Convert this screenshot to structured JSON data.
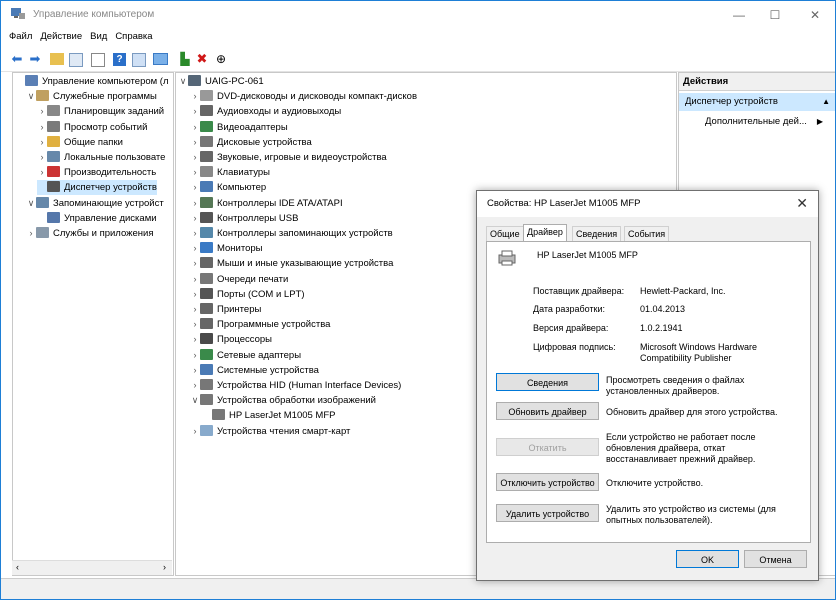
{
  "window": {
    "title": "Управление компьютером"
  },
  "menu": [
    "Файл",
    "Действие",
    "Вид",
    "Справка"
  ],
  "left_tree": [
    {
      "label": "Управление компьютером (л",
      "exp": "",
      "indent": 0,
      "color": "#5a7fb5"
    },
    {
      "label": "Служебные программы",
      "exp": "∨",
      "indent": 1,
      "color": "#c0a060"
    },
    {
      "label": "Планировщик заданий",
      "exp": "›",
      "indent": 2,
      "color": "#888"
    },
    {
      "label": "Просмотр событий",
      "exp": "›",
      "indent": 2,
      "color": "#7a7a7a"
    },
    {
      "label": "Общие папки",
      "exp": "›",
      "indent": 2,
      "color": "#e0b040"
    },
    {
      "label": "Локальные пользовате",
      "exp": "›",
      "indent": 2,
      "color": "#6688aa"
    },
    {
      "label": "Производительность",
      "exp": "›",
      "indent": 2,
      "color": "#cc3333"
    },
    {
      "label": "Диспетчер устройств",
      "exp": "",
      "indent": 2,
      "color": "#555",
      "selected": true
    },
    {
      "label": "Запоминающие устройст",
      "exp": "∨",
      "indent": 1,
      "color": "#6688aa"
    },
    {
      "label": "Управление дисками",
      "exp": "",
      "indent": 2,
      "color": "#5577aa"
    },
    {
      "label": "Службы и приложения",
      "exp": "›",
      "indent": 1,
      "color": "#8899aa"
    }
  ],
  "device_tree": [
    {
      "label": "UAIG-PC-061",
      "exp": "∨",
      "indent": 0,
      "color": "#556677"
    },
    {
      "label": "DVD-дисководы и дисководы компакт-дисков",
      "exp": "›",
      "indent": 1,
      "color": "#999"
    },
    {
      "label": "Аудиовходы и аудиовыходы",
      "exp": "›",
      "indent": 1,
      "color": "#666"
    },
    {
      "label": "Видеоадаптеры",
      "exp": "›",
      "indent": 1,
      "color": "#3a8a4a"
    },
    {
      "label": "Дисковые устройства",
      "exp": "›",
      "indent": 1,
      "color": "#777"
    },
    {
      "label": "Звуковые, игровые и видеоустройства",
      "exp": "›",
      "indent": 1,
      "color": "#666"
    },
    {
      "label": "Клавиатуры",
      "exp": "›",
      "indent": 1,
      "color": "#888"
    },
    {
      "label": "Компьютер",
      "exp": "›",
      "indent": 1,
      "color": "#4a7ab5"
    },
    {
      "label": "Контроллеры IDE ATA/ATAPI",
      "exp": "›",
      "indent": 1,
      "color": "#557755"
    },
    {
      "label": "Контроллеры USB",
      "exp": "›",
      "indent": 1,
      "color": "#555"
    },
    {
      "label": "Контроллеры запоминающих устройств",
      "exp": "›",
      "indent": 1,
      "color": "#5588aa"
    },
    {
      "label": "Мониторы",
      "exp": "›",
      "indent": 1,
      "color": "#3a7ac5"
    },
    {
      "label": "Мыши и иные указывающие устройства",
      "exp": "›",
      "indent": 1,
      "color": "#666"
    },
    {
      "label": "Очереди печати",
      "exp": "›",
      "indent": 1,
      "color": "#777"
    },
    {
      "label": "Порты (COM и LPT)",
      "exp": "›",
      "indent": 1,
      "color": "#555"
    },
    {
      "label": "Принтеры",
      "exp": "›",
      "indent": 1,
      "color": "#666"
    },
    {
      "label": "Программные устройства",
      "exp": "›",
      "indent": 1,
      "color": "#666"
    },
    {
      "label": "Процессоры",
      "exp": "›",
      "indent": 1,
      "color": "#4a4a4a"
    },
    {
      "label": "Сетевые адаптеры",
      "exp": "›",
      "indent": 1,
      "color": "#3a8a4a"
    },
    {
      "label": "Системные устройства",
      "exp": "›",
      "indent": 1,
      "color": "#4a7ab5"
    },
    {
      "label": "Устройства HID (Human Interface Devices)",
      "exp": "›",
      "indent": 1,
      "color": "#777"
    },
    {
      "label": "Устройства обработки изображений",
      "exp": "∨",
      "indent": 1,
      "color": "#777"
    },
    {
      "label": "HP LaserJet M1005 MFP",
      "exp": "",
      "indent": 2,
      "color": "#777"
    },
    {
      "label": "Устройства чтения смарт-карт",
      "exp": "›",
      "indent": 1,
      "color": "#88aacc"
    }
  ],
  "actions": {
    "header": "Действия",
    "item1": "Диспетчер устройств",
    "item2": "Дополнительные дей..."
  },
  "dialog": {
    "title": "Свойства: HP LaserJet M1005 MFP",
    "tabs": [
      "Общие",
      "Драйвер",
      "Сведения",
      "События"
    ],
    "device_name": "HP LaserJet M1005 MFP",
    "props": [
      {
        "label": "Поставщик драйвера:",
        "value": "Hewlett-Packard, Inc."
      },
      {
        "label": "Дата разработки:",
        "value": "01.04.2013"
      },
      {
        "label": "Версия драйвера:",
        "value": "1.0.2.1941"
      },
      {
        "label": "Цифровая подпись:",
        "value": "Microsoft Windows Hardware Compatibility Publisher"
      }
    ],
    "buttons": [
      {
        "label": "Сведения",
        "desc": "Просмотреть сведения о файлах установленных драйверов."
      },
      {
        "label": "Обновить драйвер",
        "desc": "Обновить драйвер для этого устройства."
      },
      {
        "label": "Откатить",
        "desc": "Если устройство не работает после обновления драйвера, откат восстанавливает прежний драйвер."
      },
      {
        "label": "Отключить устройство",
        "desc": "Отключите устройство."
      },
      {
        "label": "Удалить устройство",
        "desc": "Удалить это устройство из системы (для опытных пользователей)."
      }
    ],
    "ok": "OK",
    "cancel": "Отмена"
  }
}
